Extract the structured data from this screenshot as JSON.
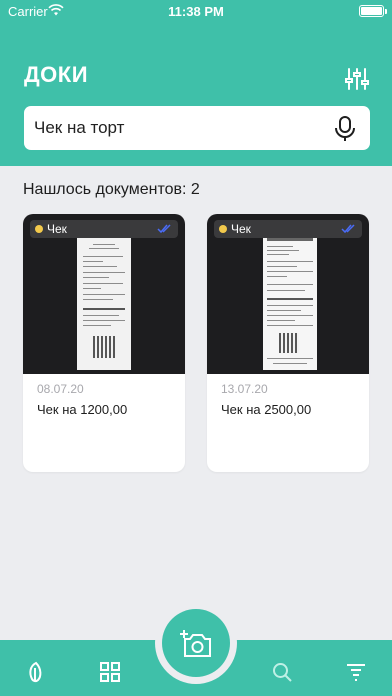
{
  "status_bar": {
    "carrier": "Carrier",
    "time": "11:38 PM"
  },
  "header": {
    "title": "ДОКИ"
  },
  "search": {
    "value": "Чек на торт"
  },
  "results": {
    "found_label": "Нашлось документов: 2"
  },
  "documents": [
    {
      "tag": "Чек",
      "date": "08.07.20",
      "title": "Чек на 1200,00"
    },
    {
      "tag": "Чек",
      "date": "13.07.20",
      "title": "Чек на 2500,00"
    }
  ],
  "colors": {
    "accent": "#3fc0a9",
    "background": "#ecedf0",
    "tag_dot": "#f2c94c",
    "check": "#4a6cf7"
  },
  "icons": {
    "header": [
      "sliders-icon"
    ],
    "search": [
      "microphone-icon"
    ],
    "card": [
      "checkmark-double-icon"
    ],
    "tabbar": [
      "leaf-icon",
      "grid-icon",
      "camera-add-icon",
      "search-icon",
      "list-icon"
    ]
  }
}
